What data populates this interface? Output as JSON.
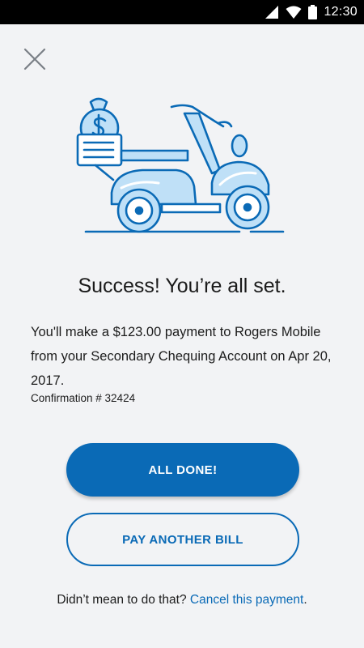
{
  "status_bar": {
    "time": "12:30",
    "icons": [
      "signal-icon",
      "wifi-icon",
      "battery-icon"
    ]
  },
  "close_icon": "close-icon",
  "illustration": "scooter-with-money-bag-illustration",
  "title": "Success! You’re all set.",
  "message": "You'll make a $123.00 payment to Rogers Mobile from your Secondary Chequing Account on Apr 20, 2017.",
  "confirmation": "Confirmation # 32424",
  "buttons": {
    "primary_label": "ALL DONE!",
    "secondary_label": "PAY ANOTHER BILL"
  },
  "footer": {
    "prompt": "Didn’t mean to do that? ",
    "link_label": "Cancel this payment",
    "suffix": "."
  },
  "colors": {
    "accent": "#0a6ab6",
    "background": "#f2f3f5",
    "illustration_fill": "#bfe0f7",
    "illustration_stroke": "#0a6ab6"
  }
}
